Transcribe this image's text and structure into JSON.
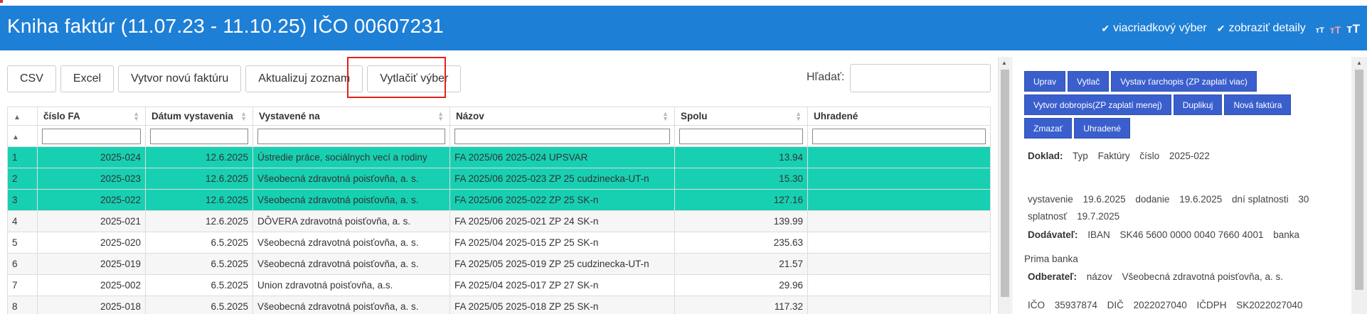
{
  "header": {
    "title": "Kniha faktúr (11.07.23 - 11.10.25) IČO 00607231",
    "options": [
      {
        "label": "viacriadkový výber",
        "checked": true
      },
      {
        "label": "zobraziť detaily",
        "checked": true
      }
    ],
    "font_size_glyph": "тТ"
  },
  "toolbar": {
    "buttons": [
      "CSV",
      "Excel",
      "Vytvor novú faktúru",
      "Aktualizuj zoznam",
      "Vytlačiť výber"
    ],
    "highlighted_button": "Vytlačiť výber",
    "search_label": "Hľadať:",
    "search_value": ""
  },
  "table": {
    "columns": [
      "",
      "číslo FA",
      "Dátum vystavenia",
      "Vystavené na",
      "Názov",
      "Spolu",
      "Uhradené"
    ],
    "sort_indicator": "▲",
    "rows": [
      {
        "idx": "1",
        "cislo": "2025-024",
        "datum": "12.6.2025",
        "vystavene": "Ústredie práce, sociálnych vecí a rodiny",
        "nazov": "FA 2025/06 2025-024 UPSVAR",
        "spolu": "13.94",
        "uhradene": "",
        "selected": true
      },
      {
        "idx": "2",
        "cislo": "2025-023",
        "datum": "12.6.2025",
        "vystavene": "Všeobecná zdravotná poisťovňa, a. s.",
        "nazov": "FA 2025/06 2025-023 ZP 25 cudzinecka-UT-n",
        "spolu": "15.30",
        "uhradene": "",
        "selected": true
      },
      {
        "idx": "3",
        "cislo": "2025-022",
        "datum": "12.6.2025",
        "vystavene": "Všeobecná zdravotná poisťovňa, a. s.",
        "nazov": "FA 2025/06 2025-022 ZP 25 SK-n",
        "spolu": "127.16",
        "uhradene": "",
        "selected": true
      },
      {
        "idx": "4",
        "cislo": "2025-021",
        "datum": "12.6.2025",
        "vystavene": "DÔVERA zdravotná poisťovňa, a. s.",
        "nazov": "FA 2025/06 2025-021 ZP 24 SK-n",
        "spolu": "139.99",
        "uhradene": "",
        "selected": false
      },
      {
        "idx": "5",
        "cislo": "2025-020",
        "datum": "6.5.2025",
        "vystavene": "Všeobecná zdravotná poisťovňa, a. s.",
        "nazov": "FA 2025/04 2025-015 ZP 25 SK-n",
        "spolu": "235.63",
        "uhradene": "",
        "selected": false
      },
      {
        "idx": "6",
        "cislo": "2025-019",
        "datum": "6.5.2025",
        "vystavene": "Všeobecná zdravotná poisťovňa, a. s.",
        "nazov": "FA 2025/05 2025-019 ZP 25 cudzinecka-UT-n",
        "spolu": "21.57",
        "uhradene": "",
        "selected": false
      },
      {
        "idx": "7",
        "cislo": "2025-002",
        "datum": "6.5.2025",
        "vystavene": "Union zdravotná poisťovňa, a.s.",
        "nazov": "FA 2025/04 2025-017 ZP 27 SK-n",
        "spolu": "29.96",
        "uhradene": "",
        "selected": false
      },
      {
        "idx": "8",
        "cislo": "2025-018",
        "datum": "6.5.2025",
        "vystavene": "Všeobecná zdravotná poisťovňa, a. s.",
        "nazov": "FA 2025/05 2025-018 ZP 25 SK-n",
        "spolu": "117.32",
        "uhradene": "",
        "selected": false
      }
    ]
  },
  "detail": {
    "buttons": [
      "Uprav",
      "Vytlač",
      "Vystav ťarchopis (ZP zaplatí viac)",
      "Vytvor dobropis(ZP zaplatí menej)",
      "Duplikuj",
      "Nová faktúra",
      "Zmazať",
      "Uhradené"
    ],
    "doklad_label": "Doklad:",
    "typ_label": "Typ",
    "typ_value": "Faktúry",
    "cislo_label": "číslo",
    "cislo_value": "2025-022",
    "vystavenie_label": "vystavenie",
    "vystavenie_value": "19.6.2025",
    "dodanie_label": "dodanie",
    "dodanie_value": "19.6.2025",
    "dni_label": "dní splatnosti",
    "dni_value": "30",
    "splatnost_label": "splatnosť",
    "splatnost_value": "19.7.2025",
    "dodavatel_label": "Dodávateľ:",
    "iban_label": "IBAN",
    "iban_value": "SK46 5600 0000 0040 7660 4001",
    "banka_label": "banka",
    "banka_value": "Prima banka",
    "odberatel_label": "Odberateľ:",
    "nazov_label": "názov",
    "nazov_value": "Všeobecná zdravotná poisťovňa, a. s.",
    "ico_label": "IČO",
    "ico_value": "35937874",
    "dic_label": "DIČ",
    "dic_value": "2022027040",
    "icdph_label": "IČDPH",
    "icdph_value": "SK2022027040"
  }
}
